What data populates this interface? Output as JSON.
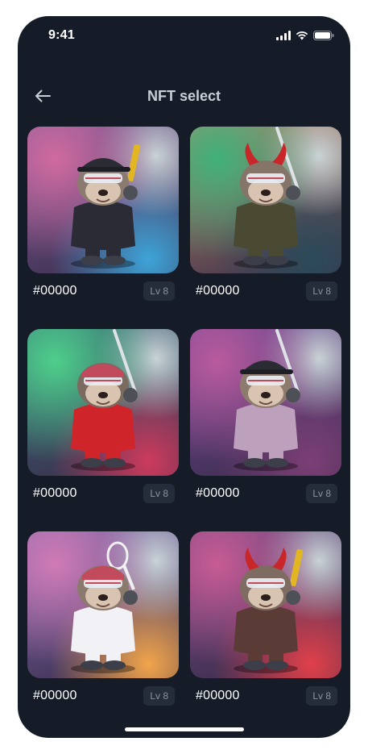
{
  "status": {
    "time": "9:41"
  },
  "header": {
    "title": "NFT select"
  },
  "nfts": [
    {
      "id": "#00000",
      "level": "Lv 8",
      "palette": [
        "#d06a9f",
        "#7a5d9b",
        "#3ea4d8"
      ],
      "fur": "#8b7a70",
      "outfit": "#2a2b35",
      "headwear": "cap",
      "accessory": "gun"
    },
    {
      "id": "#00000",
      "level": "Lv 8",
      "palette": [
        "#3fb17a",
        "#b98f6c",
        "#2c4b5a"
      ],
      "fur": "#857568",
      "outfit": "#4a4a33",
      "headwear": "horns",
      "accessory": "bat"
    },
    {
      "id": "#00000",
      "level": "Lv 8",
      "palette": [
        "#4ecf8a",
        "#3a6c7d",
        "#cd3b5e"
      ],
      "fur": "#7a6a60",
      "outfit": "#d0242b",
      "headwear": "bandana",
      "accessory": "bat"
    },
    {
      "id": "#00000",
      "level": "Lv 8",
      "palette": [
        "#b95a9d",
        "#6d4a99",
        "#7c3f76"
      ],
      "fur": "#8d7b6e",
      "outfit": "#bca0bc",
      "headwear": "cap",
      "accessory": "bat"
    },
    {
      "id": "#00000",
      "level": "Lv 8",
      "palette": [
        "#d07ab5",
        "#7d6db1",
        "#f1a54c"
      ],
      "fur": "#8a7a6e",
      "outfit": "#f2f2f6",
      "headwear": "bandana",
      "accessory": "racket"
    },
    {
      "id": "#00000",
      "level": "Lv 8",
      "palette": [
        "#c85b94",
        "#6f4a86",
        "#e0404a"
      ],
      "fur": "#7e6c62",
      "outfit": "#5a3b36",
      "headwear": "horns",
      "accessory": "gun"
    }
  ]
}
